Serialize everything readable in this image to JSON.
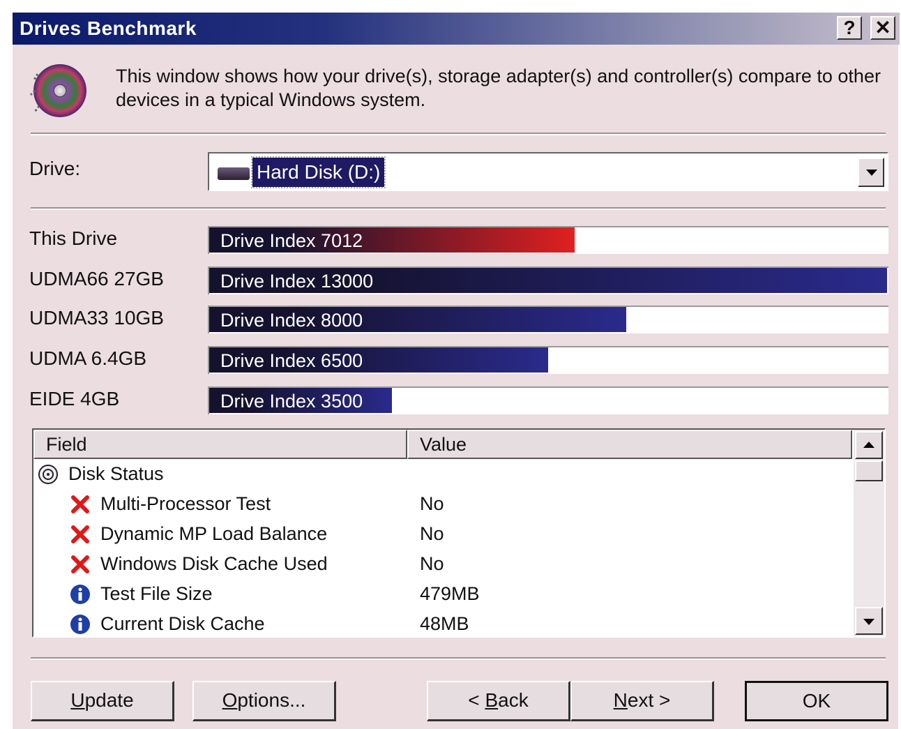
{
  "window": {
    "title": "Drives Benchmark",
    "help_label": "?",
    "close_label": "✕"
  },
  "description": "This window shows how your drive(s), storage adapter(s) and controller(s) compare to other devices in a typical Windows system.",
  "drive_select": {
    "label": "Drive:",
    "value": "Hard Disk (D:)"
  },
  "benchmarks": [
    {
      "label": "This Drive",
      "text": "Drive Index 7012",
      "index": 7012,
      "color": "#e02020"
    },
    {
      "label": "UDMA66 27GB",
      "text": "Drive Index 13000",
      "index": 13000,
      "color": "#2a2a8c"
    },
    {
      "label": "UDMA33 10GB",
      "text": "Drive Index 8000",
      "index": 8000,
      "color": "#2a2a8c"
    },
    {
      "label": "UDMA 6.4GB",
      "text": "Drive Index 6500",
      "index": 6500,
      "color": "#2a2a8c"
    },
    {
      "label": "EIDE 4GB",
      "text": "Drive Index 3500",
      "index": 3500,
      "color": "#2a2a8c"
    }
  ],
  "benchmark_scale_max": 13000,
  "list": {
    "col_field": "Field",
    "col_value": "Value",
    "rows": [
      {
        "field": "Disk Status",
        "value": "",
        "icon": "disk-icon",
        "level": 0
      },
      {
        "field": "Multi-Processor Test",
        "value": "No",
        "icon": "red-x-icon",
        "level": 1
      },
      {
        "field": "Dynamic MP Load Balance",
        "value": "No",
        "icon": "red-x-icon",
        "level": 1
      },
      {
        "field": "Windows Disk Cache Used",
        "value": "No",
        "icon": "red-x-icon",
        "level": 1
      },
      {
        "field": "Test File Size",
        "value": "479MB",
        "icon": "info-icon",
        "level": 1
      },
      {
        "field": "Current Disk Cache",
        "value": "48MB",
        "icon": "info-icon",
        "level": 1
      }
    ]
  },
  "buttons": {
    "update": {
      "mnemonic": "U",
      "rest": "pdate"
    },
    "options": {
      "mnemonic": "O",
      "rest": "ptions..."
    },
    "back": {
      "pre": "< ",
      "mnemonic": "B",
      "rest": "ack"
    },
    "next": {
      "mnemonic": "N",
      "rest": "ext >"
    },
    "ok": "OK"
  }
}
